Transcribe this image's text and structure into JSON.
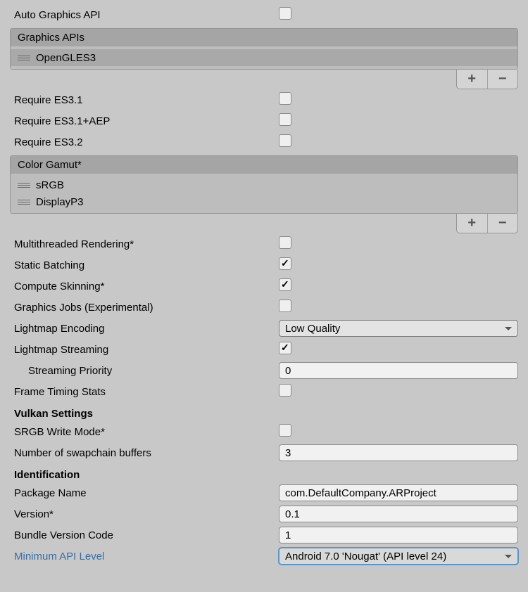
{
  "settings": {
    "auto_graphics_api_label": "Auto Graphics API",
    "auto_graphics_api_checked": false,
    "graphics_apis_header": "Graphics APIs",
    "graphics_apis_items": [
      {
        "name": "OpenGLES3"
      }
    ],
    "require_es31_label": "Require ES3.1",
    "require_es31_checked": false,
    "require_es31_aep_label": "Require ES3.1+AEP",
    "require_es31_aep_checked": false,
    "require_es32_label": "Require ES3.2",
    "require_es32_checked": false,
    "color_gamut_header": "Color Gamut*",
    "color_gamut_items": [
      {
        "name": "sRGB"
      },
      {
        "name": "DisplayP3"
      }
    ],
    "multithreaded_label": "Multithreaded Rendering*",
    "multithreaded_checked": false,
    "static_batching_label": "Static Batching",
    "static_batching_checked": true,
    "compute_skinning_label": "Compute Skinning*",
    "compute_skinning_checked": true,
    "graphics_jobs_label": "Graphics Jobs (Experimental)",
    "graphics_jobs_checked": false,
    "lightmap_encoding_label": "Lightmap Encoding",
    "lightmap_encoding_value": "Low Quality",
    "lightmap_streaming_label": "Lightmap Streaming",
    "lightmap_streaming_checked": true,
    "streaming_priority_label": "Streaming Priority",
    "streaming_priority_value": "0",
    "frame_timing_label": "Frame Timing Stats",
    "frame_timing_checked": false
  },
  "vulkan": {
    "heading": "Vulkan Settings",
    "srgb_write_label": "SRGB Write Mode*",
    "srgb_write_checked": false,
    "swapchain_label": "Number of swapchain buffers",
    "swapchain_value": "3"
  },
  "identification": {
    "heading": "Identification",
    "package_name_label": "Package Name",
    "package_name_value": "com.DefaultCompany.ARProject",
    "version_label": "Version*",
    "version_value": "0.1",
    "bundle_code_label": "Bundle Version Code",
    "bundle_code_value": "1",
    "min_api_label": "Minimum API Level",
    "min_api_value": "Android 7.0 'Nougat' (API level 24)"
  },
  "icons": {
    "plus": "+",
    "minus": "−"
  }
}
